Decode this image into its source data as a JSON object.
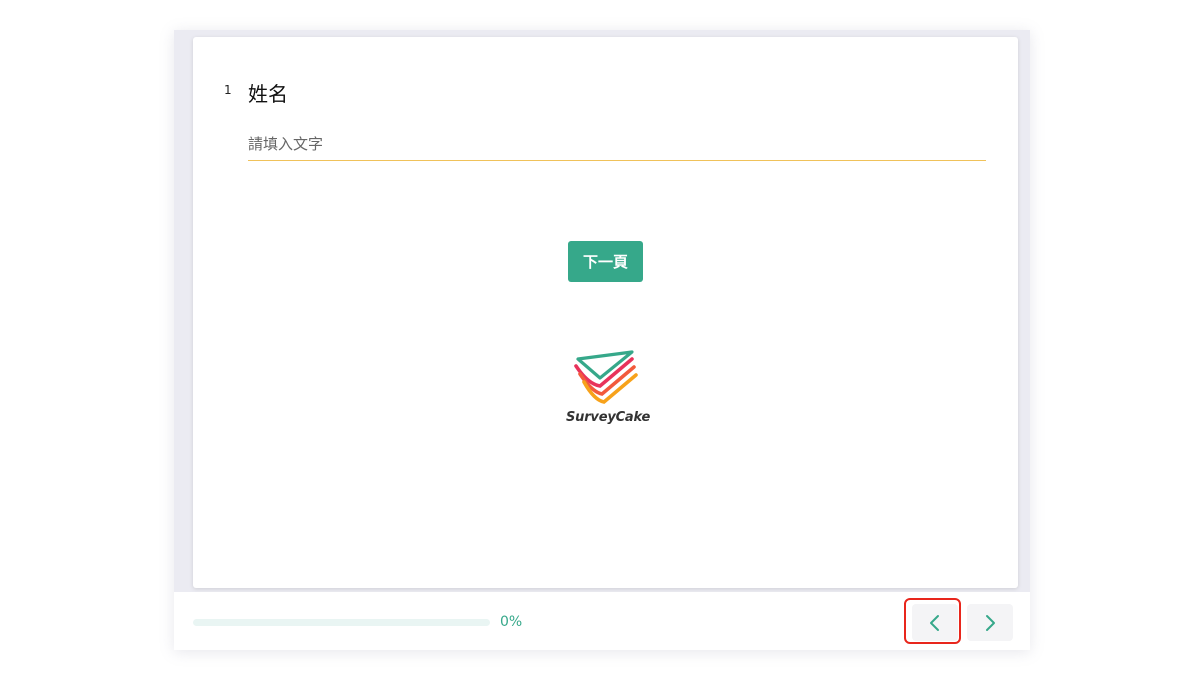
{
  "question": {
    "number": "1",
    "title": "姓名",
    "input_placeholder": "請填入文字",
    "input_value": ""
  },
  "actions": {
    "next_page_label": "下一頁"
  },
  "branding": {
    "logo_text": "SurveyCake",
    "colors": [
      "#36a88a",
      "#e8335b",
      "#f25a3c",
      "#f7a21b"
    ]
  },
  "footer": {
    "progress_label": "0%",
    "progress_value": 0,
    "prev_icon": "chevron-left-icon",
    "next_icon": "chevron-right-icon"
  },
  "theme": {
    "accent": "#36a88a",
    "input_underline": "#f0c25a",
    "highlight": "#e8261c"
  }
}
